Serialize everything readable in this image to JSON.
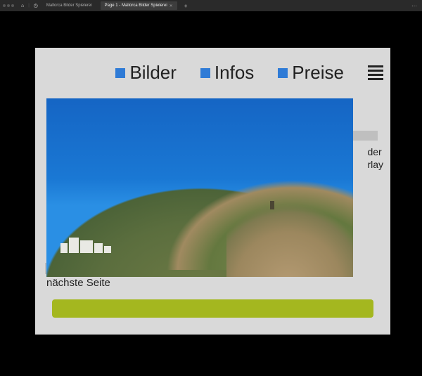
{
  "appbar": {
    "tab_inactive": "Mallorca Bilder Spielerei",
    "tab_active": "Page 1 - Mallorca Bilder Spielerei"
  },
  "nav": {
    "item1": "Bilder",
    "item2": "Infos",
    "item3": "Preise"
  },
  "side": {
    "line1": "der",
    "line2": "rlay"
  },
  "caption": "nächste Seite",
  "colors": {
    "accent_square": "#2f7bd6",
    "bar": "#a4b71f",
    "canvas": "#d9d9d9"
  }
}
